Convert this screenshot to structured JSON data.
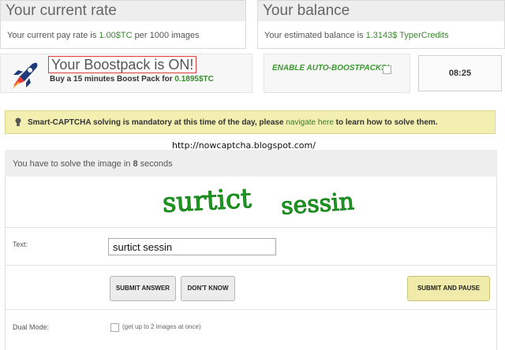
{
  "rate": {
    "title": "Your current rate",
    "prefix": "Your current pay rate is ",
    "value": "1.00$TC",
    "suffix": " per 1000 images"
  },
  "balance": {
    "title": "Your balance",
    "prefix": "Your estimated balance is ",
    "value": "1.3143$ TyperCredits"
  },
  "boost": {
    "title": "Your Boostpack is ON!",
    "sub_prefix": "Buy a 15 minutes Boost Pack for ",
    "sub_value": "0.1895$TC"
  },
  "auto_boost": {
    "label": "ENABLE AUTO-BOOSTPACKS!"
  },
  "timer": {
    "value": "08:25"
  },
  "notice": {
    "bold_text": "Smart-CAPTCHA solving is mandatory at this time of the day, please ",
    "link_text": "navigate here",
    "rest_text": " to learn how to solve them."
  },
  "watermark_url": "http://nowcaptcha.blogspot.com/",
  "solve": {
    "prefix": "You have to solve the image in ",
    "seconds": "8",
    "suffix": " seconds"
  },
  "captcha": {
    "word1": "surtict",
    "word2": "sessin"
  },
  "form": {
    "text_label": "Text:",
    "text_value": "surtict sessin",
    "submit_label": "SUBMIT ANSWER",
    "dontknow_label": "DON'T KNOW",
    "submitpause_label": "SUBMIT AND PAUSE",
    "dual_label": "Dual Mode:",
    "dual_note": "(get up to 2 images at once)"
  },
  "colors": {
    "green": "#3a8a2e",
    "notice_bg": "#f2efb0",
    "boost_border": "#e23b3b",
    "captcha_green": "#1e9a1e"
  },
  "icons": {
    "rocket": "rocket-icon",
    "bulb": "lightbulb-icon"
  }
}
